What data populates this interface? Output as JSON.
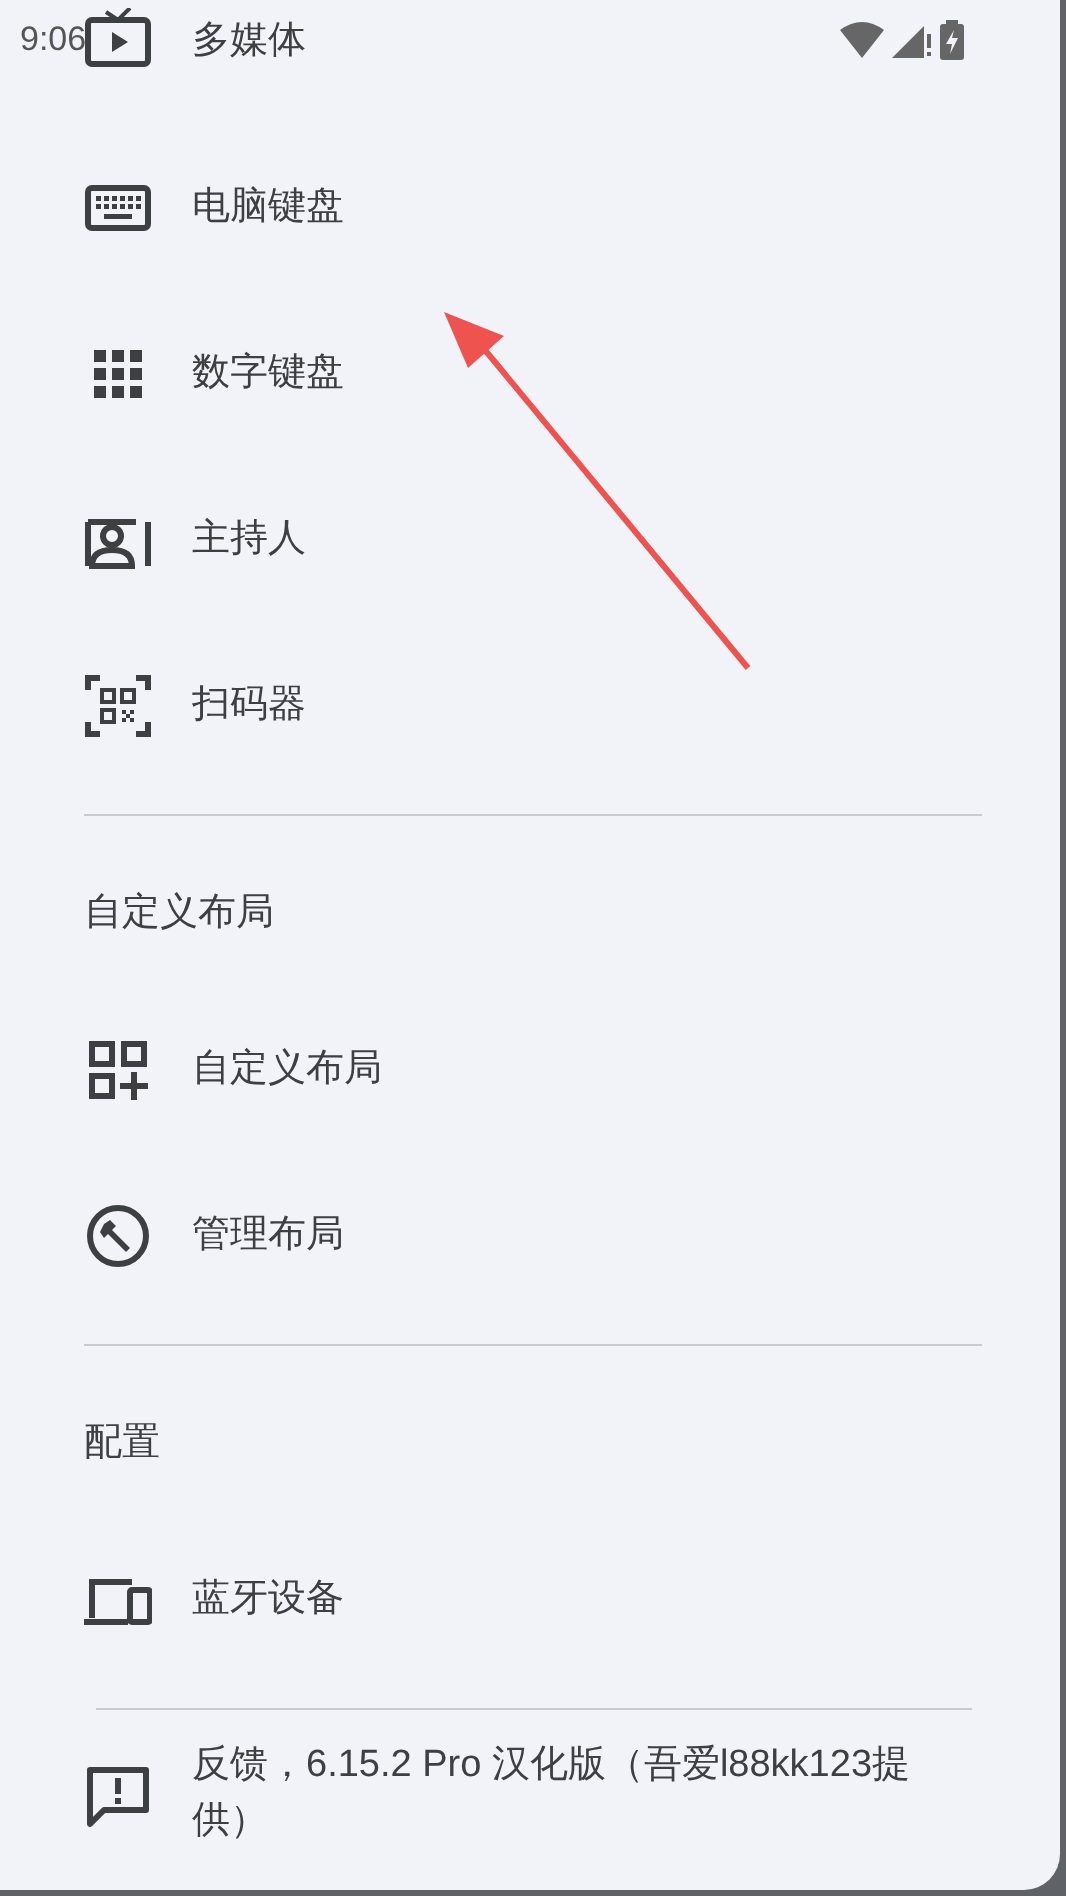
{
  "status_bar": {
    "time": "9:06"
  },
  "sections": [
    {
      "items": [
        {
          "kind": "tv",
          "label": "多媒体"
        },
        {
          "kind": "keyboard",
          "label": "电脑键盘"
        },
        {
          "kind": "dialpad",
          "label": "数字键盘"
        },
        {
          "kind": "presenter",
          "label": "主持人"
        },
        {
          "kind": "scanner",
          "label": "扫码器"
        }
      ]
    },
    {
      "header": "自定义布局",
      "items": [
        {
          "kind": "grid-add",
          "label": "自定义布局"
        },
        {
          "kind": "wrench",
          "label": "管理布局"
        }
      ]
    },
    {
      "header": "配置",
      "items": [
        {
          "kind": "devices",
          "label": "蓝牙设备"
        }
      ]
    },
    {
      "items": [
        {
          "kind": "feedback",
          "label": "反馈，6.15.2 Pro 汉化版（吾爱l88kk123提供）"
        }
      ]
    }
  ]
}
